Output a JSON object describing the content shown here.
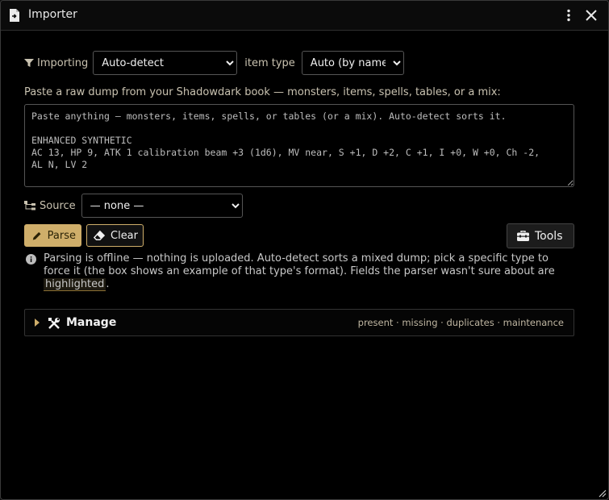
{
  "window": {
    "title": "Importer",
    "icons": {
      "title": "file-import-icon",
      "menu": "kebab-menu-icon",
      "close": "close-icon",
      "resize": "resize-grip-icon"
    }
  },
  "filters": {
    "importing_label": "Importing",
    "importing_value": "Auto-detect",
    "item_type_label": "item type",
    "item_type_value": "Auto (by name)"
  },
  "paste": {
    "label": "Paste a raw dump from your Shadowdark book — monsters, items, spells, tables, or a mix:",
    "placeholder": "Paste anything — monsters, items, spells, or tables (or a mix). Auto-detect sorts it.\n\nENHANCED SYNTHETIC\nAC 13, HP 9, ATK 1 calibration beam +3 (1d6), MV near, S +1, D +2, C +1, I +0, W +0, Ch -2,\nAL N, LV 2"
  },
  "source": {
    "label": "Source",
    "value": "— none —"
  },
  "actions": {
    "parse_label": "Parse",
    "clear_label": "Clear",
    "tools_label": "Tools"
  },
  "info": {
    "text": "Parsing is offline — nothing is uploaded. Auto-detect sorts a mixed dump; pick a specific type to force it (the box shows an example of that type's format). Fields the parser wasn't sure about are",
    "highlight": "highlighted",
    "tail": "."
  },
  "manage": {
    "label": "Manage",
    "hint": "present · missing · duplicates · maintenance"
  },
  "colors": {
    "accent": "#cfae6a",
    "background": "#000000",
    "text": "#f0f0f0",
    "muted": "#c9c2b0"
  }
}
